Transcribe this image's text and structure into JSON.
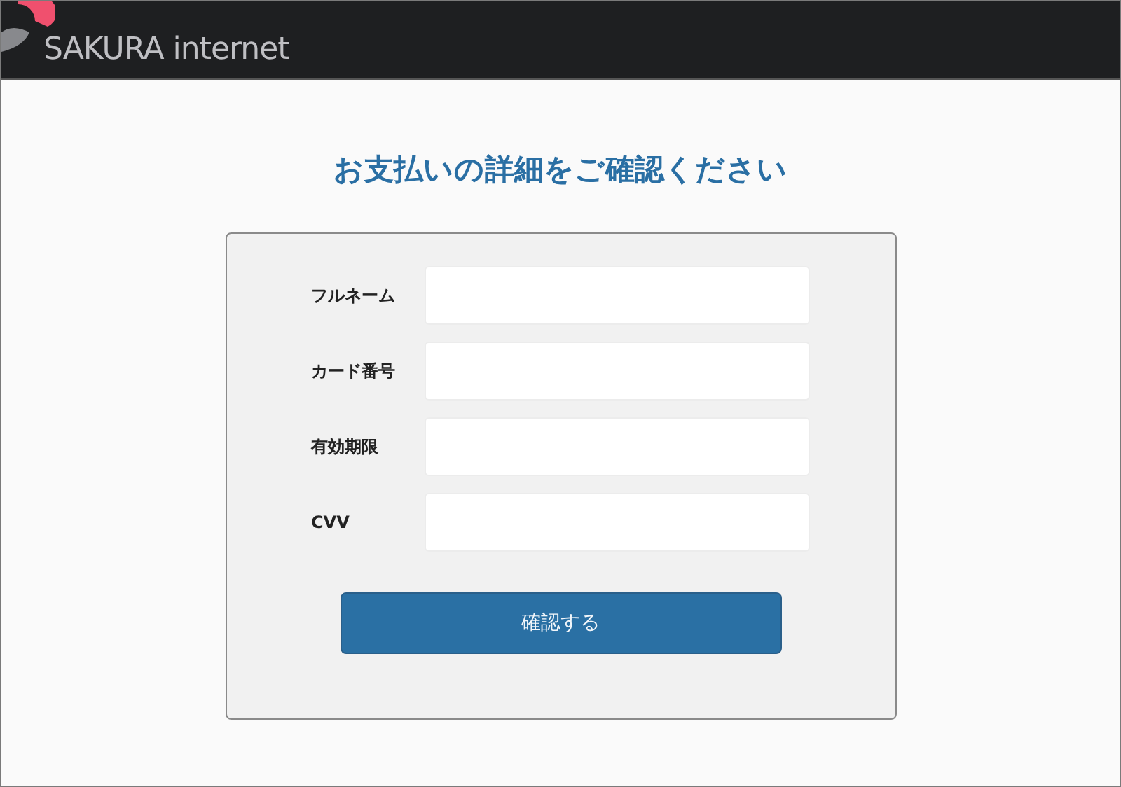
{
  "header": {
    "brand": "SAKURA internet"
  },
  "title": "お支払いの詳細をご確認ください",
  "form": {
    "fields": [
      {
        "label": "フルネーム"
      },
      {
        "label": "カード番号"
      },
      {
        "label": "有効期限"
      },
      {
        "label": "CVV"
      }
    ],
    "submit": "確認する"
  }
}
